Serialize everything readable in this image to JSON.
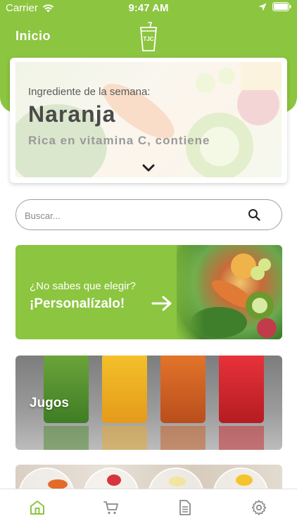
{
  "status_bar": {
    "carrier": "Carrier",
    "time": "9:47 AM",
    "icons": [
      "wifi-icon",
      "location-arrow-icon",
      "battery-icon"
    ]
  },
  "nav": {
    "title": "Inicio",
    "logo_text": "TJC"
  },
  "ingredient_card": {
    "kicker": "Ingrediente de la semana:",
    "name": "Naranja",
    "description": "Rica en vitamina C, contiene",
    "expand_icon": "chevron-down-icon"
  },
  "search": {
    "placeholder": "Buscar...",
    "value": "",
    "icon": "search-icon"
  },
  "categories": [
    {
      "id": "personalize",
      "question": "¿No sabes que elegir?",
      "cta": "¡Personalízalo!",
      "icon": "arrow-right-icon"
    },
    {
      "id": "juices",
      "label": "Jugos"
    },
    {
      "id": "smoothies",
      "label": ""
    }
  ],
  "tab_bar": {
    "tabs": [
      {
        "id": "home",
        "icon": "home-icon",
        "active": true
      },
      {
        "id": "cart",
        "icon": "cart-icon",
        "active": false
      },
      {
        "id": "orders",
        "icon": "document-icon",
        "active": false
      },
      {
        "id": "settings",
        "icon": "gear-icon",
        "active": false
      }
    ]
  },
  "colors": {
    "brand_green": "#8cc540",
    "tab_active": "#8cc540",
    "tab_inactive": "#8a8a8a",
    "text_dark": "#4a4a4a"
  }
}
